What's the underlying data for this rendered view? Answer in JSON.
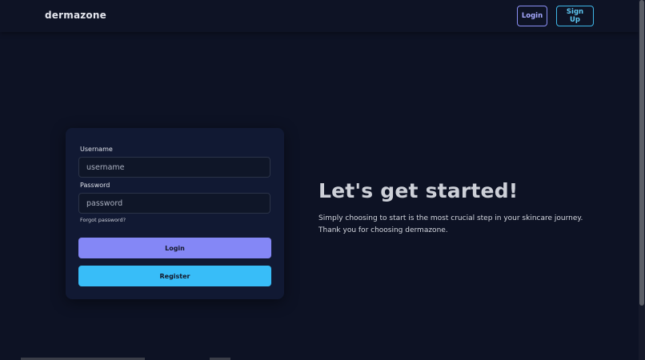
{
  "header": {
    "brand": "dermazone",
    "login_label": "Login",
    "signup_label": "Sign Up"
  },
  "form": {
    "username_label": "Username",
    "username_placeholder": "username",
    "password_label": "Password",
    "password_placeholder": "password",
    "forgot_label": "Forgot password?",
    "login_button": "Login",
    "register_button": "Register"
  },
  "hero": {
    "title": "Let's get started!",
    "line1": "Simply choosing to start is the most crucial step in your skincare journey.",
    "line2": "Thank you for choosing dermazone."
  },
  "colors": {
    "background": "#0d1224",
    "card": "#111933",
    "login_accent": "#8487f6",
    "register_accent": "#38bdf8"
  }
}
